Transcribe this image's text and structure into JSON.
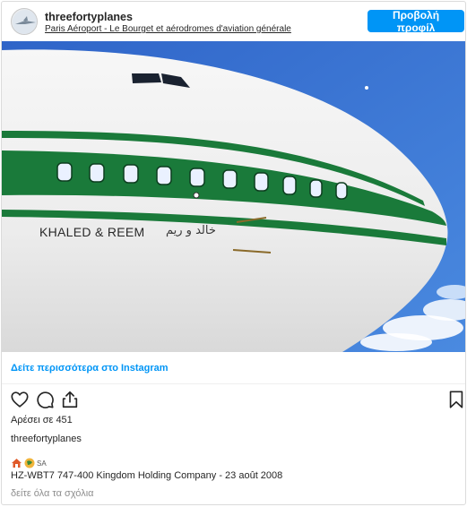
{
  "header": {
    "username": "threefortyplanes",
    "location": "Paris Aéroport - Le Bourget et aérodromes d'aviation générale",
    "profile_button": "Προβολή προφίλ"
  },
  "photo": {
    "livery_text": "KHALED & REEM",
    "livery_arabic": "خالد و ريم"
  },
  "see_more": "Δείτε περισσότερα στο Instagram",
  "actions": {
    "icons": [
      "heart-icon",
      "comment-icon",
      "share-icon",
      "bookmark-icon"
    ]
  },
  "likes": "Αρέσει σε 451",
  "caption": {
    "username": "threefortyplanes",
    "badge_label": "SA",
    "text": "HZ-WBT7 747-400 Kingdom Holding Company - 23 août 2008"
  },
  "comments_link": "δείτε όλα τα σχόλια",
  "colors": {
    "accent": "#0095f6",
    "sky": "#2f6fd0",
    "livery_green": "#1a7a3a"
  }
}
